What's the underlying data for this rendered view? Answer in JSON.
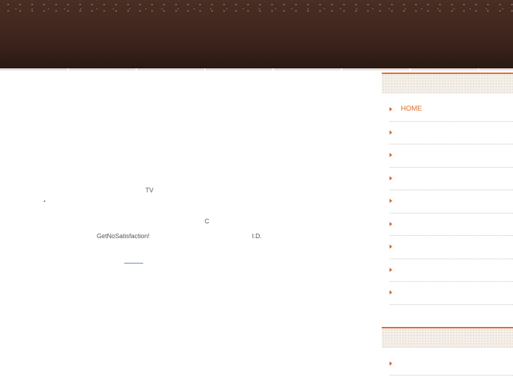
{
  "main": {
    "texts": [
      {
        "id": "tv",
        "text": "TV"
      },
      {
        "id": "dot",
        "text": "•"
      },
      {
        "id": "c",
        "text": "C"
      },
      {
        "id": "gns",
        "text": "GetNoSatisfaction!"
      },
      {
        "id": "id",
        "text": "I.D."
      }
    ]
  },
  "sidebar": {
    "menu": [
      {
        "label": "HOME"
      },
      {
        "label": ""
      },
      {
        "label": ""
      },
      {
        "label": ""
      },
      {
        "label": ""
      },
      {
        "label": ""
      },
      {
        "label": ""
      },
      {
        "label": ""
      },
      {
        "label": ""
      }
    ],
    "menu2": [
      {
        "label": ""
      }
    ]
  },
  "colors": {
    "accent": "#e06a2b",
    "header_dark": "#3e261d",
    "link": "#6a84c8"
  }
}
